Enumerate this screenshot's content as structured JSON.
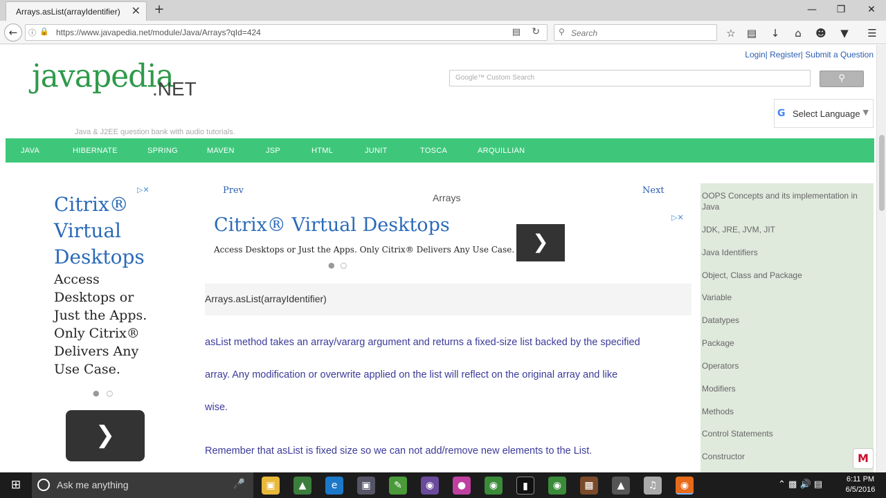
{
  "browser": {
    "tab_title": "Arrays.asList(arrayIdentifier)",
    "tab_close": "✕",
    "new_tab": "+",
    "url": "https://www.javapedia.net/module/Java/Arrays?qId=424",
    "search_placeholder": "Search"
  },
  "site": {
    "top_links": [
      "Login|",
      "Register|",
      "Submit a Question"
    ],
    "logo_main": "javapedia",
    "logo_net": ".NET",
    "tagline": "Java & J2EE question bank with audio tutorials.",
    "google_search_placeholder": "Google™ Custom Search",
    "select_language": "Select Language",
    "menu": [
      "JAVA",
      "HIBERNATE",
      "SPRING",
      "MAVEN",
      "JSP",
      "HTML",
      "JUNIT",
      "TOSCA",
      "ARQUILLIAN"
    ]
  },
  "ad_left": {
    "title": "Citrix® Virtual Desktops",
    "body": "Access Desktops or Just the Apps. Only Citrix® Delivers Any Use Case."
  },
  "main": {
    "prev": "Prev",
    "next": "Next",
    "heading": "Arrays",
    "ad_title": "Citrix® Virtual Desktops",
    "ad_body": "Access Desktops or Just the Apps. Only Citrix® Delivers Any Use Case.",
    "question": "Arrays.asList(arrayIdentifier)",
    "para1_line1": "asList method takes an array/vararg argument and returns a fixed-size list backed by the specified",
    "para1_line2": "array. Any modification or overwrite applied on the list will reflect on the original array and like",
    "para1_line3": "wise.",
    "para2": "Remember that asList is fixed size so we can not add/remove new elements to the List."
  },
  "sidebar": {
    "items": [
      "OOPS Concepts and its implementation in Java",
      "JDK, JRE, JVM, JIT",
      "Java Identifiers",
      "Object, Class and Package",
      "Variable",
      "Datatypes",
      "Package",
      "Operators",
      "Modifiers",
      "Methods",
      "Control Statements",
      "Constructor"
    ]
  },
  "taskbar": {
    "cortana_text": "Ask me anything",
    "time": "6:11 PM",
    "date": "6/5/2016"
  }
}
